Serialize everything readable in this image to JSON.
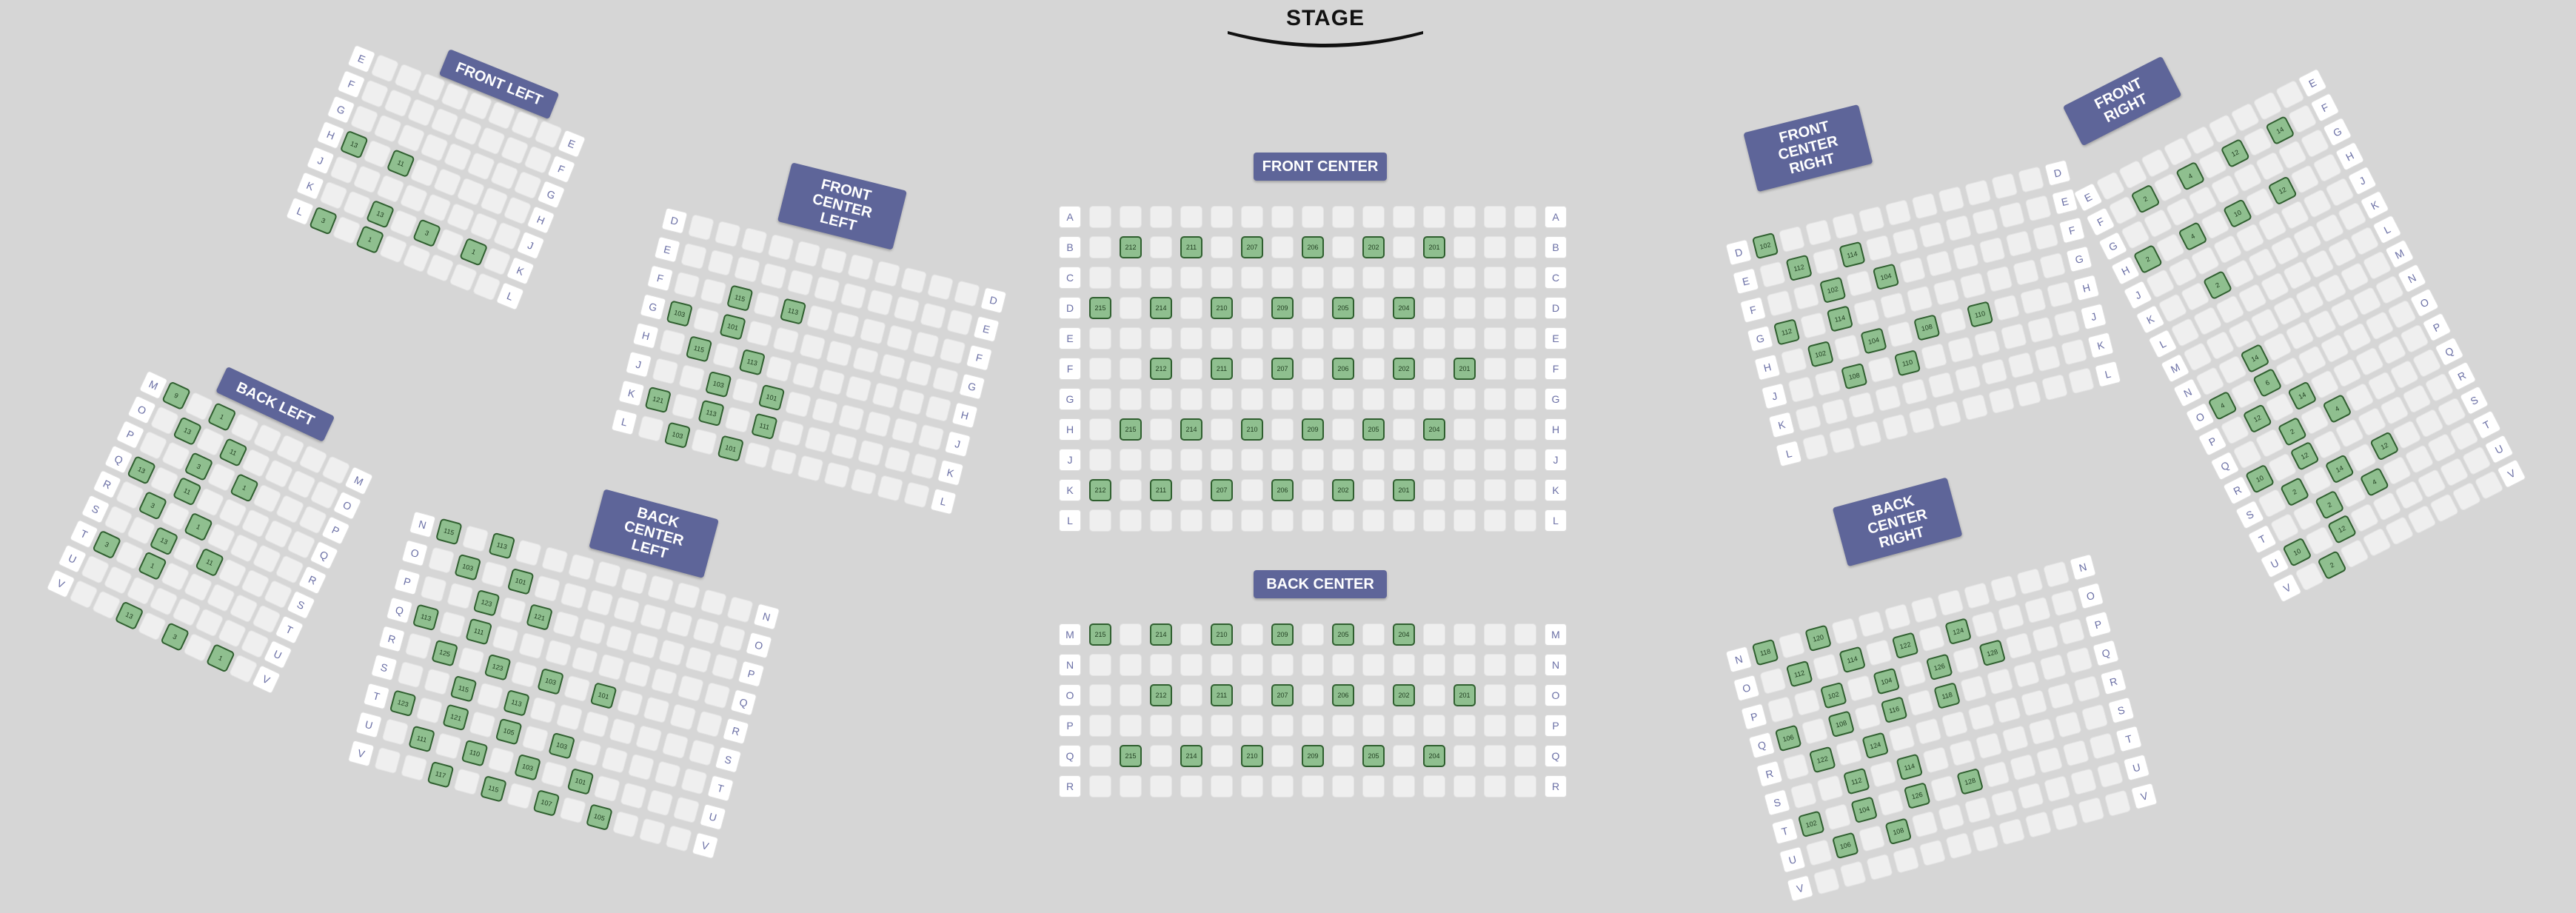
{
  "stage": {
    "title": "STAGE"
  },
  "sections": [
    {
      "id": "front-center",
      "label": "FRONT CENTER",
      "label_lines": [
        "FRONT CENTER"
      ],
      "rows": [
        "A",
        "B",
        "C",
        "D",
        "E",
        "F",
        "G",
        "H",
        "J",
        "K",
        "L"
      ],
      "seats_per_row": 15,
      "selected": [
        {
          "row": "B",
          "seat": 212
        },
        {
          "row": "B",
          "seat": 211
        },
        {
          "row": "B",
          "seat": 207
        },
        {
          "row": "B",
          "seat": 206
        },
        {
          "row": "B",
          "seat": 202
        },
        {
          "row": "B",
          "seat": 201
        },
        {
          "row": "D",
          "seat": 215
        },
        {
          "row": "D",
          "seat": 214
        },
        {
          "row": "D",
          "seat": 210
        },
        {
          "row": "D",
          "seat": 209
        },
        {
          "row": "D",
          "seat": 205
        },
        {
          "row": "D",
          "seat": 204
        },
        {
          "row": "F",
          "seat": 212
        },
        {
          "row": "F",
          "seat": 211
        },
        {
          "row": "F",
          "seat": 207
        },
        {
          "row": "F",
          "seat": 206
        },
        {
          "row": "F",
          "seat": 202
        },
        {
          "row": "F",
          "seat": 201
        },
        {
          "row": "H",
          "seat": 215
        },
        {
          "row": "H",
          "seat": 214
        },
        {
          "row": "H",
          "seat": 210
        },
        {
          "row": "H",
          "seat": 209
        },
        {
          "row": "H",
          "seat": 205
        },
        {
          "row": "H",
          "seat": 204
        },
        {
          "row": "K",
          "seat": 212
        },
        {
          "row": "K",
          "seat": 211
        },
        {
          "row": "K",
          "seat": 207
        },
        {
          "row": "K",
          "seat": 206
        },
        {
          "row": "K",
          "seat": 202
        },
        {
          "row": "K",
          "seat": 201
        }
      ]
    },
    {
      "id": "back-center",
      "label": "BACK CENTER",
      "label_lines": [
        "BACK CENTER"
      ],
      "rows": [
        "M",
        "N",
        "O",
        "P",
        "Q",
        "R"
      ],
      "seats_per_row": 15,
      "selected": [
        {
          "row": "M",
          "seat": 215
        },
        {
          "row": "M",
          "seat": 214
        },
        {
          "row": "M",
          "seat": 210
        },
        {
          "row": "M",
          "seat": 209
        },
        {
          "row": "M",
          "seat": 205
        },
        {
          "row": "M",
          "seat": 204
        },
        {
          "row": "O",
          "seat": 212
        },
        {
          "row": "O",
          "seat": 211
        },
        {
          "row": "O",
          "seat": 207
        },
        {
          "row": "O",
          "seat": 206
        },
        {
          "row": "O",
          "seat": 202
        },
        {
          "row": "O",
          "seat": 201
        },
        {
          "row": "Q",
          "seat": 215
        },
        {
          "row": "Q",
          "seat": 214
        },
        {
          "row": "Q",
          "seat": 210
        },
        {
          "row": "Q",
          "seat": 209
        },
        {
          "row": "Q",
          "seat": 205
        },
        {
          "row": "Q",
          "seat": 204
        }
      ]
    },
    {
      "id": "front-left",
      "label": "FRONT LEFT",
      "label_lines": [
        "FRONT LEFT"
      ],
      "rows": [
        "E",
        "F",
        "G",
        "H",
        "J",
        "K",
        "L"
      ],
      "seats_per_row": 8,
      "selected": [
        {
          "row": "H",
          "seat": 13
        },
        {
          "row": "H",
          "seat": 11
        },
        {
          "row": "K",
          "seat": 13
        },
        {
          "row": "K",
          "seat": 3
        },
        {
          "row": "K",
          "seat": 1
        },
        {
          "row": "L",
          "seat": 3
        },
        {
          "row": "L",
          "seat": 1
        }
      ]
    },
    {
      "id": "front-center-left",
      "label": "FRONT CENTER LEFT",
      "label_lines": [
        "FRONT CENTER",
        "LEFT"
      ],
      "rows": [
        "D",
        "E",
        "F",
        "G",
        "H",
        "J",
        "K",
        "L"
      ],
      "seats_per_row": 11,
      "selected": [
        {
          "row": "F",
          "seat": 115
        },
        {
          "row": "F",
          "seat": 113
        },
        {
          "row": "G",
          "seat": 103
        },
        {
          "row": "G",
          "seat": 101
        },
        {
          "row": "H",
          "seat": 115
        },
        {
          "row": "H",
          "seat": 113
        },
        {
          "row": "J",
          "seat": 103
        },
        {
          "row": "J",
          "seat": 101
        },
        {
          "row": "K",
          "seat": 121
        },
        {
          "row": "K",
          "seat": 113
        },
        {
          "row": "K",
          "seat": 111
        },
        {
          "row": "L",
          "seat": 103
        },
        {
          "row": "L",
          "seat": 101
        }
      ]
    },
    {
      "id": "back-left",
      "label": "BACK LEFT",
      "label_lines": [
        "BACK LEFT"
      ],
      "rows": [
        "M",
        "O",
        "P",
        "Q",
        "R",
        "S",
        "T",
        "U",
        "V"
      ],
      "seats_per_row": 8,
      "selected": [
        {
          "row": "M",
          "seat": 9
        },
        {
          "row": "O",
          "seat": 13
        },
        {
          "row": "O",
          "seat": 11
        },
        {
          "row": "Q",
          "seat": 13
        },
        {
          "row": "Q",
          "seat": 11
        },
        {
          "row": "S",
          "seat": 13
        },
        {
          "row": "S",
          "seat": 11
        },
        {
          "row": "V",
          "seat": 13
        },
        {
          "row": "M",
          "seat": 1
        },
        {
          "row": "P",
          "seat": 3
        },
        {
          "row": "P",
          "seat": 1
        },
        {
          "row": "R",
          "seat": 3
        },
        {
          "row": "R",
          "seat": 1
        },
        {
          "row": "T",
          "seat": 3
        },
        {
          "row": "T",
          "seat": 1
        },
        {
          "row": "V",
          "seat": 3
        },
        {
          "row": "V",
          "seat": 1
        }
      ]
    },
    {
      "id": "back-center-left",
      "label": "BACK CENTER LEFT",
      "label_lines": [
        "BACK CENTER",
        "LEFT"
      ],
      "rows": [
        "N",
        "O",
        "P",
        "Q",
        "R",
        "S",
        "T",
        "U",
        "V"
      ],
      "seats_per_row": 12,
      "selected": [
        {
          "row": "N",
          "seat": 115
        },
        {
          "row": "N",
          "seat": 113
        },
        {
          "row": "O",
          "seat": 103
        },
        {
          "row": "O",
          "seat": 101
        },
        {
          "row": "P",
          "seat": 123
        },
        {
          "row": "P",
          "seat": 121
        },
        {
          "row": "Q",
          "seat": 113
        },
        {
          "row": "Q",
          "seat": 111
        },
        {
          "row": "R",
          "seat": 125
        },
        {
          "row": "R",
          "seat": 123
        },
        {
          "row": "R",
          "seat": 103
        },
        {
          "row": "R",
          "seat": 101
        },
        {
          "row": "S",
          "seat": 115
        },
        {
          "row": "S",
          "seat": 113
        },
        {
          "row": "T",
          "seat": 123
        },
        {
          "row": "T",
          "seat": 121
        },
        {
          "row": "T",
          "seat": 105
        },
        {
          "row": "T",
          "seat": 103
        },
        {
          "row": "U",
          "seat": 111
        },
        {
          "row": "U",
          "seat": 110
        },
        {
          "row": "U",
          "seat": 103
        },
        {
          "row": "U",
          "seat": 101
        },
        {
          "row": "V",
          "seat": 117
        },
        {
          "row": "V",
          "seat": 115
        },
        {
          "row": "V",
          "seat": 107
        },
        {
          "row": "V",
          "seat": 105
        }
      ]
    },
    {
      "id": "front-center-right",
      "label": "FRONT CENTER RIGHT",
      "label_lines": [
        "FRONT CENTER",
        "RIGHT"
      ],
      "rows": [
        "D",
        "E",
        "F",
        "G",
        "H",
        "J",
        "K",
        "L"
      ],
      "seats_per_row": 11,
      "selected": [
        {
          "row": "D",
          "seat": 102
        },
        {
          "row": "E",
          "seat": 112
        },
        {
          "row": "E",
          "seat": 114
        },
        {
          "row": "F",
          "seat": 102
        },
        {
          "row": "F",
          "seat": 104
        },
        {
          "row": "G",
          "seat": 112
        },
        {
          "row": "G",
          "seat": 114
        },
        {
          "row": "H",
          "seat": 102
        },
        {
          "row": "H",
          "seat": 104
        },
        {
          "row": "H",
          "seat": 108
        },
        {
          "row": "H",
          "seat": 110
        },
        {
          "row": "J",
          "seat": 108
        },
        {
          "row": "J",
          "seat": 110
        }
      ]
    },
    {
      "id": "front-right",
      "label": "FRONT RIGHT",
      "label_lines": [
        "FRONT RIGHT"
      ],
      "rows": [
        "E",
        "F",
        "G",
        "H",
        "J",
        "K",
        "L",
        "M",
        "N",
        "O",
        "P",
        "Q",
        "R",
        "S",
        "T",
        "U",
        "V"
      ],
      "seats_per_row": 9,
      "selected": [
        {
          "row": "F",
          "seat": 2
        },
        {
          "row": "F",
          "seat": 4
        },
        {
          "row": "H",
          "seat": 2
        },
        {
          "row": "H",
          "seat": 4
        },
        {
          "row": "K",
          "seat": 2
        },
        {
          "row": "F",
          "seat": 12
        },
        {
          "row": "F",
          "seat": 14
        },
        {
          "row": "H",
          "seat": 10
        },
        {
          "row": "H",
          "seat": 12
        },
        {
          "row": "N",
          "seat": 14
        },
        {
          "row": "O",
          "seat": 4
        },
        {
          "row": "O",
          "seat": 6
        },
        {
          "row": "P",
          "seat": 12
        },
        {
          "row": "P",
          "seat": 14
        },
        {
          "row": "Q",
          "seat": 2
        },
        {
          "row": "Q",
          "seat": 4
        },
        {
          "row": "R",
          "seat": 10
        },
        {
          "row": "R",
          "seat": 12
        },
        {
          "row": "S",
          "seat": 2
        },
        {
          "row": "S",
          "seat": 14
        },
        {
          "row": "S",
          "seat": 12
        },
        {
          "row": "T",
          "seat": 2
        },
        {
          "row": "T",
          "seat": 4
        },
        {
          "row": "U",
          "seat": 10
        },
        {
          "row": "U",
          "seat": 12
        },
        {
          "row": "V",
          "seat": 2
        }
      ]
    },
    {
      "id": "back-center-right",
      "label": "BACK CENTER RIGHT",
      "label_lines": [
        "BACK CENTER",
        "RIGHT"
      ],
      "rows": [
        "N",
        "O",
        "P",
        "Q",
        "R",
        "S",
        "T",
        "U",
        "V"
      ],
      "seats_per_row": 12,
      "selected": [
        {
          "row": "N",
          "seat": 118
        },
        {
          "row": "N",
          "seat": 120
        },
        {
          "row": "O",
          "seat": 112
        },
        {
          "row": "O",
          "seat": 114
        },
        {
          "row": "O",
          "seat": 122
        },
        {
          "row": "O",
          "seat": 124
        },
        {
          "row": "P",
          "seat": 102
        },
        {
          "row": "P",
          "seat": 104
        },
        {
          "row": "P",
          "seat": 126
        },
        {
          "row": "P",
          "seat": 128
        },
        {
          "row": "Q",
          "seat": 106
        },
        {
          "row": "Q",
          "seat": 108
        },
        {
          "row": "Q",
          "seat": 116
        },
        {
          "row": "Q",
          "seat": 118
        },
        {
          "row": "R",
          "seat": 122
        },
        {
          "row": "R",
          "seat": 124
        },
        {
          "row": "S",
          "seat": 112
        },
        {
          "row": "S",
          "seat": 114
        },
        {
          "row": "T",
          "seat": 102
        },
        {
          "row": "T",
          "seat": 104
        },
        {
          "row": "T",
          "seat": 126
        },
        {
          "row": "T",
          "seat": 128
        },
        {
          "row": "U",
          "seat": 106
        },
        {
          "row": "U",
          "seat": 108
        }
      ]
    }
  ],
  "colors": {
    "background": "#d6d6d6",
    "seat_available": "#efefef",
    "seat_selected": "#8fbf8f",
    "seat_selected_border": "#2f5f2f",
    "label_bg": "#5e6599",
    "row_label_text": "#6a6fa5"
  }
}
